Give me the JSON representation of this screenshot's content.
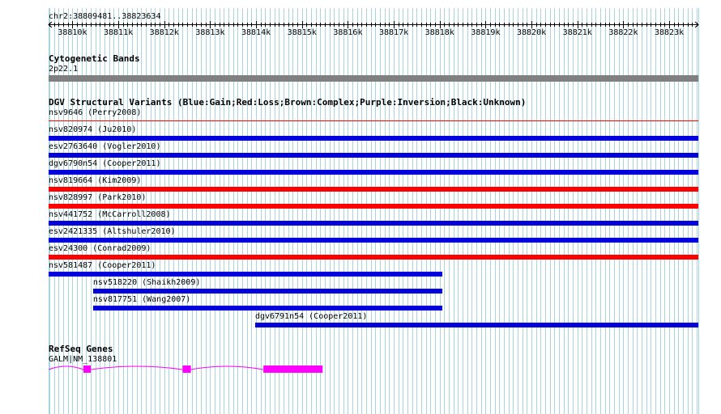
{
  "ruler": {
    "location": "chr2:38809481..38823634",
    "start": 38809481,
    "end": 38823634,
    "tick_labels": [
      "38810k",
      "38811k",
      "38812k",
      "38813k",
      "38814k",
      "38815k",
      "38816k",
      "38817k",
      "38818k",
      "38819k",
      "38820k",
      "38821k",
      "38822k",
      "38823k"
    ],
    "tick_positions": [
      38810000,
      38811000,
      38812000,
      38813000,
      38814000,
      38815000,
      38816000,
      38817000,
      38818000,
      38819000,
      38820000,
      38821000,
      38822000,
      38823000
    ]
  },
  "cytoband": {
    "title": "Cytogenetic Bands",
    "band": "2p22.1",
    "color": "#808080"
  },
  "dgv": {
    "title": "DGV Structural Variants (Blue:Gain;Red:Loss;Brown:Complex;Purple:Inversion;Black:Unknown)",
    "colors": {
      "gain": "#0000dd",
      "loss": "#ff0000"
    },
    "variants": [
      {
        "label": "nsv9646 (Perry2008)",
        "type": "loss",
        "start": 38809481,
        "end": 38823634,
        "thin": true
      },
      {
        "label": "nsv820974 (Ju2010)",
        "type": "gain",
        "start": 38809481,
        "end": 38823634
      },
      {
        "label": "esv2763640 (Vogler2010)",
        "type": "gain",
        "start": 38809481,
        "end": 38823634
      },
      {
        "label": "dgv6790n54 (Cooper2011)",
        "type": "gain",
        "start": 38809481,
        "end": 38823634
      },
      {
        "label": "nsv819664 (Kim2009)",
        "type": "loss",
        "start": 38809481,
        "end": 38823634
      },
      {
        "label": "nsv828997 (Park2010)",
        "type": "loss",
        "start": 38809481,
        "end": 38823634
      },
      {
        "label": "nsv441752 (McCarroll2008)",
        "type": "gain",
        "start": 38809481,
        "end": 38823634
      },
      {
        "label": "esv2421335 (Altshuler2010)",
        "type": "gain",
        "start": 38809481,
        "end": 38823634
      },
      {
        "label": "esv24300 (Conrad2009)",
        "type": "loss",
        "start": 38809481,
        "end": 38823634
      },
      {
        "label": "nsv581487 (Cooper2011)",
        "type": "gain",
        "start": 38809481,
        "end": 38818050
      },
      {
        "label": "nsv518220 (Shaikh2009)",
        "type": "gain",
        "start": 38810450,
        "end": 38818060
      },
      {
        "label": "nsv817751 (Wang2007)",
        "type": "gain",
        "start": 38810450,
        "end": 38818060
      },
      {
        "label": "dgv6791n54 (Cooper2011)",
        "type": "gain",
        "start": 38813980,
        "end": 38823634
      }
    ]
  },
  "refseq": {
    "title": "RefSeq Genes",
    "gene_label": "GALM|NM_138801",
    "color": "#ff00ff",
    "gene_start": 38809481,
    "gene_end": 38815450,
    "exons": [
      {
        "start": 38810240,
        "end": 38810400
      },
      {
        "start": 38812400,
        "end": 38812580
      },
      {
        "start": 38814160,
        "end": 38815450
      }
    ]
  }
}
